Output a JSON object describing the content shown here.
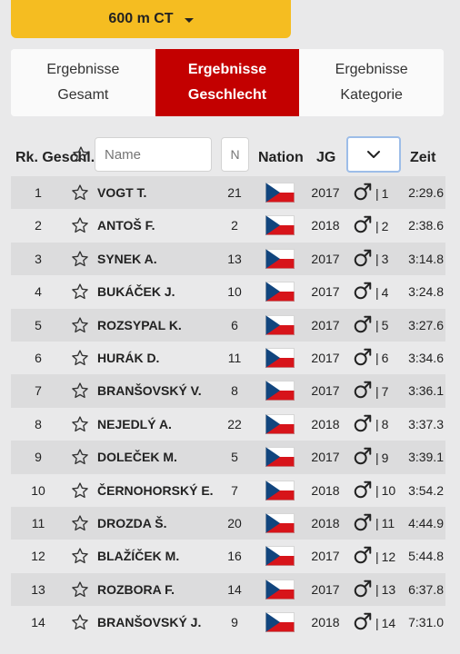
{
  "race_selector": {
    "label": "600 m CT"
  },
  "tabs": [
    {
      "line1": "Ergebnisse",
      "line2": "Gesamt",
      "active": false
    },
    {
      "line1": "Ergebnisse",
      "line2": "Geschlecht",
      "active": true
    },
    {
      "line1": "Ergebnisse",
      "line2": "Kategorie",
      "active": false
    }
  ],
  "columns": {
    "rank": "Rk. Geschl.",
    "name_placeholder": "Name",
    "number_placeholder": "N",
    "nation": "Nation",
    "year": "JG",
    "time": "Zeit"
  },
  "icons": {
    "favorite": "star-outline-icon",
    "gender": "male-symbol-icon",
    "flag": "czech-flag-icon",
    "dropdown": "chevron-down-icon"
  },
  "colors": {
    "accent": "#f5bd21",
    "active_tab": "#c30000"
  },
  "rows": [
    {
      "rank": "1",
      "name": "VOGT T.",
      "number": "21",
      "year": "2017",
      "gender_rank": "1",
      "time": "2:29.6"
    },
    {
      "rank": "2",
      "name": "ANTOŠ F.",
      "number": "2",
      "year": "2018",
      "gender_rank": "2",
      "time": "2:38.6"
    },
    {
      "rank": "3",
      "name": "SYNEK A.",
      "number": "13",
      "year": "2017",
      "gender_rank": "3",
      "time": "3:14.8"
    },
    {
      "rank": "4",
      "name": "BUKÁČEK J.",
      "number": "10",
      "year": "2017",
      "gender_rank": "4",
      "time": "3:24.8"
    },
    {
      "rank": "5",
      "name": "ROZSYPAL K.",
      "number": "6",
      "year": "2017",
      "gender_rank": "5",
      "time": "3:27.6"
    },
    {
      "rank": "6",
      "name": "HURÁK D.",
      "number": "11",
      "year": "2017",
      "gender_rank": "6",
      "time": "3:34.6"
    },
    {
      "rank": "7",
      "name": "BRANŠOVSKÝ V.",
      "number": "8",
      "year": "2017",
      "gender_rank": "7",
      "time": "3:36.1"
    },
    {
      "rank": "8",
      "name": "NEJEDLÝ A.",
      "number": "22",
      "year": "2018",
      "gender_rank": "8",
      "time": "3:37.3"
    },
    {
      "rank": "9",
      "name": "DOLEČEK M.",
      "number": "5",
      "year": "2017",
      "gender_rank": "9",
      "time": "3:39.1"
    },
    {
      "rank": "10",
      "name": "ČERNOHORSKÝ E.",
      "number": "7",
      "year": "2018",
      "gender_rank": "10",
      "time": "3:54.2"
    },
    {
      "rank": "11",
      "name": "DROZDA Š.",
      "number": "20",
      "year": "2018",
      "gender_rank": "11",
      "time": "4:44.9"
    },
    {
      "rank": "12",
      "name": "BLAŽÍČEK M.",
      "number": "16",
      "year": "2017",
      "gender_rank": "12",
      "time": "5:44.8"
    },
    {
      "rank": "13",
      "name": "ROZBORA F.",
      "number": "14",
      "year": "2017",
      "gender_rank": "13",
      "time": "6:37.8"
    },
    {
      "rank": "14",
      "name": "BRANŠOVSKÝ J.",
      "number": "9",
      "year": "2018",
      "gender_rank": "14",
      "time": "7:31.0"
    }
  ]
}
